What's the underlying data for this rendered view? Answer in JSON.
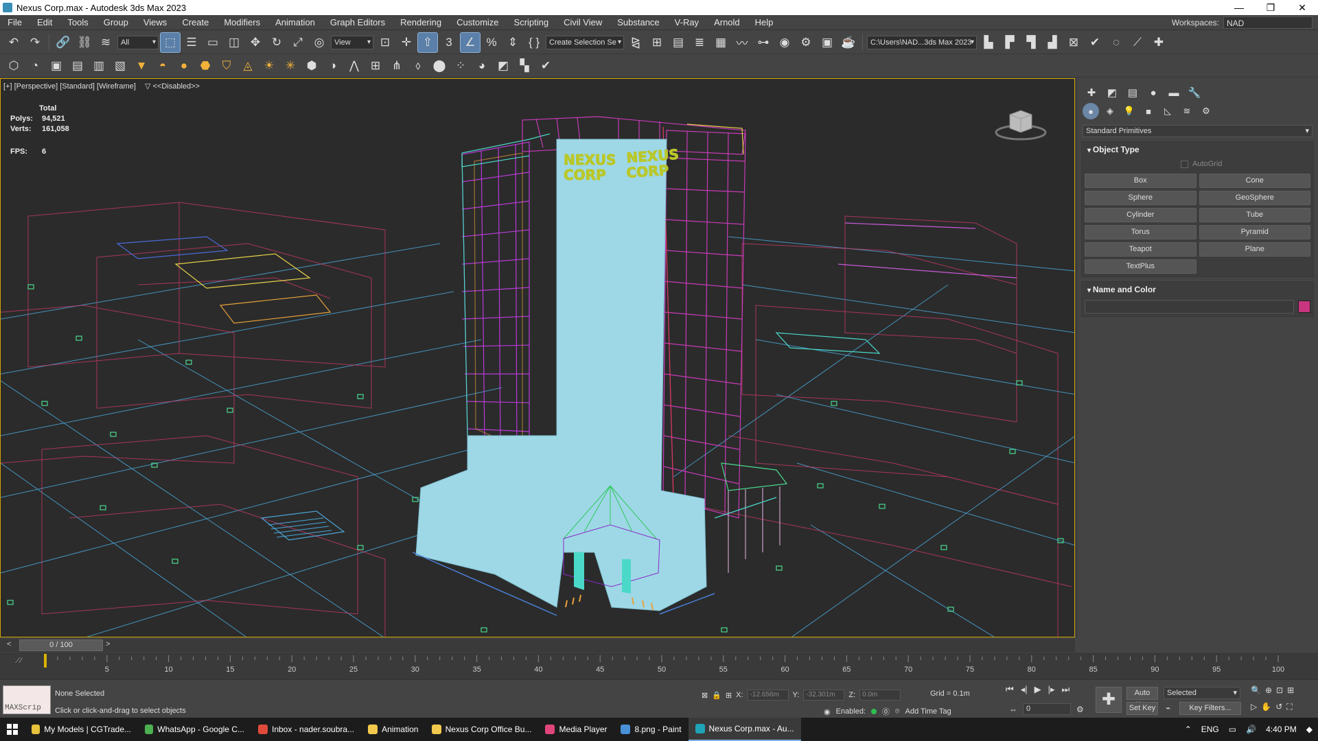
{
  "window": {
    "title": "Nexus Corp.max - Autodesk 3ds Max 2023",
    "minimize": "—",
    "maximize": "❐",
    "close": "✕"
  },
  "menu": {
    "items": [
      "File",
      "Edit",
      "Tools",
      "Group",
      "Views",
      "Create",
      "Modifiers",
      "Animation",
      "Graph Editors",
      "Rendering",
      "Customize",
      "Scripting",
      "Civil View",
      "Substance",
      "V-Ray",
      "Arnold",
      "Help"
    ],
    "workspaces_label": "Workspaces:",
    "workspaces_value": "NAD"
  },
  "toolbar": {
    "filter": "All",
    "ref_coord": "View",
    "selection_set": "Create Selection Se",
    "project_path": "C:\\Users\\NAD...3ds Max 2023"
  },
  "viewport": {
    "label": "[+] [Perspective] [Standard] [Wireframe]",
    "filter_label": "<<Disabled>>",
    "stats_header": "Total",
    "polys_label": "Polys:",
    "polys_value": "94,521",
    "verts_label": "Verts:",
    "verts_value": "161,058",
    "fps_label": "FPS:",
    "fps_value": "6",
    "sign_text_1": "NEXUS",
    "sign_text_2": "CORP"
  },
  "command_panel": {
    "category": "Standard Primitives",
    "object_type_title": "Object Type",
    "autogrid_label": "AutoGrid",
    "buttons": [
      "Box",
      "Cone",
      "Sphere",
      "GeoSphere",
      "Cylinder",
      "Tube",
      "Torus",
      "Pyramid",
      "Teapot",
      "Plane",
      "TextPlus"
    ],
    "name_color_title": "Name and Color",
    "color": "#c8357e"
  },
  "timeline": {
    "frame_display": "0 / 100",
    "ticks": [
      "5",
      "10",
      "15",
      "20",
      "25",
      "30",
      "35",
      "40",
      "45",
      "50",
      "55",
      "60",
      "65",
      "70",
      "75",
      "80",
      "85",
      "90",
      "95",
      "100"
    ]
  },
  "status": {
    "maxscript_label": "MAXScrip",
    "selection": "None Selected",
    "prompt": "Click or click-and-drag to select objects",
    "x_label": "X:",
    "x_value": "-12.656m",
    "y_label": "Y:",
    "y_value": "-32.301m",
    "z_label": "Z:",
    "z_value": "0.0m",
    "grid": "Grid = 0.1m",
    "enabled_label": "Enabled:",
    "add_time_tag": "Add Time Tag",
    "auto_key": "Auto Key",
    "set_key": "Set Key",
    "selected": "Selected",
    "key_filters": "Key Filters...",
    "current_frame": "0"
  },
  "taskbar": {
    "items": [
      {
        "label": "My Models | CGTrade...",
        "color": "#e9c23b"
      },
      {
        "label": "WhatsApp - Google C...",
        "color": "#4caf50"
      },
      {
        "label": "Inbox - nader.soubra...",
        "color": "#e04a3a"
      },
      {
        "label": "Animation",
        "color": "#f2c94c"
      },
      {
        "label": "Nexus Corp Office Bu...",
        "color": "#f2c94c"
      },
      {
        "label": "Media Player",
        "color": "#e0457b"
      },
      {
        "label": "8.png - Paint",
        "color": "#4a90d9"
      },
      {
        "label": "Nexus Corp.max - Au...",
        "color": "#1fa3b8"
      }
    ],
    "lang": "ENG",
    "time": "4:40 PM"
  }
}
